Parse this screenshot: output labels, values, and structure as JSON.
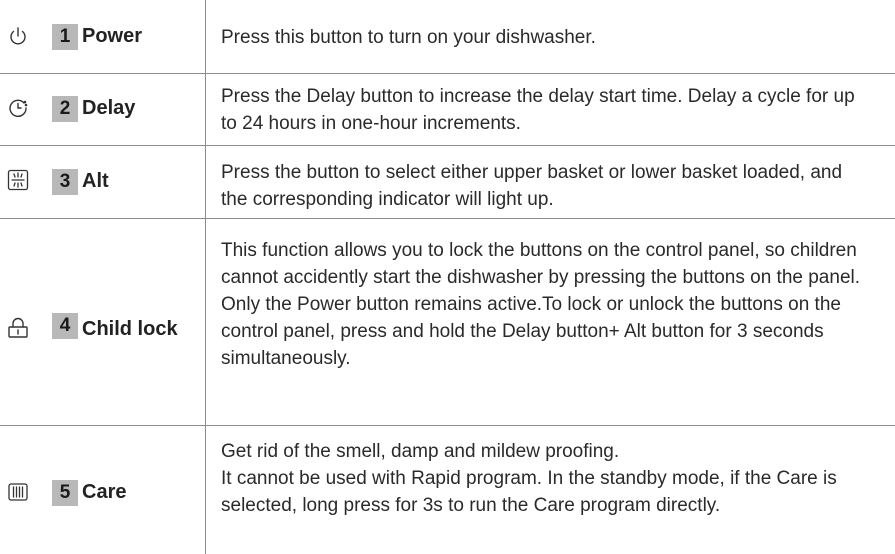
{
  "rows": [
    {
      "icon": "power-icon",
      "number": "1",
      "name": "Power",
      "description": "Press this button to turn on your dishwasher."
    },
    {
      "icon": "delay-clock-icon",
      "number": "2",
      "name": "Delay",
      "description": "Press the Delay button to increase the delay start time. Delay a cycle for up to 24 hours in one-hour increments."
    },
    {
      "icon": "alt-basket-icon",
      "number": "3",
      "name": "Alt",
      "description": "Press the button to select either upper basket or lower basket loaded, and the corresponding indicator will light up."
    },
    {
      "icon": "lock-icon",
      "number": "4",
      "name": "Child lock",
      "description": "This function allows you to lock the buttons on the control panel, so children cannot accidently start the dishwasher by pressing the buttons on the panel. Only the Power button remains active.To lock or unlock the buttons on the control panel, press and hold the Delay button+ Alt button for 3 seconds simultaneously."
    },
    {
      "icon": "care-icon",
      "number": "5",
      "name": "Care",
      "description_line1": "Get rid of the smell, damp and mildew proofing.",
      "description_line2": "It cannot be used with Rapid program. In the standby mode, if the Care is selected, long press for 3s to run the Care program directly."
    }
  ]
}
